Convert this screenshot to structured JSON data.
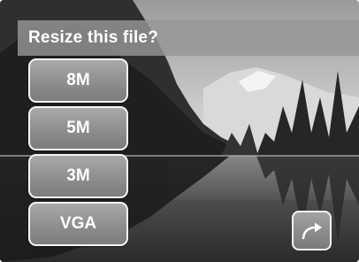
{
  "dialog": {
    "title": "Resize this file?"
  },
  "size_options": [
    {
      "label": "8M"
    },
    {
      "label": "5M"
    },
    {
      "label": "3M"
    },
    {
      "label": "VGA"
    }
  ],
  "controls": {
    "exit_icon": "return-arrow-icon"
  },
  "background": {
    "subject": "lake-forest-mountain-reflection",
    "mode": "grayscale"
  }
}
